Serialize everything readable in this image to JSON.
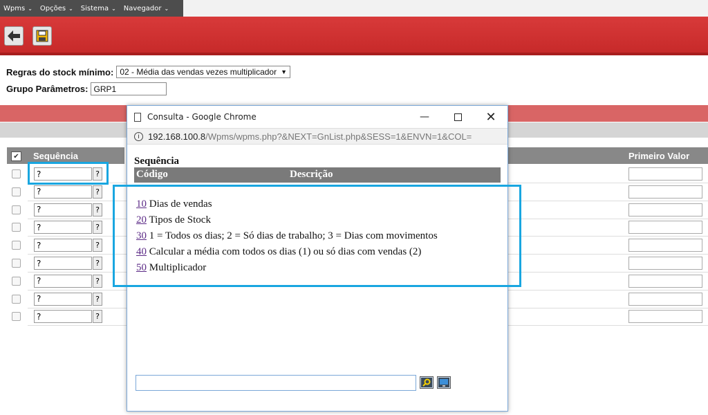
{
  "menubar": {
    "items": [
      {
        "label": "Wpms"
      },
      {
        "label": "Opções"
      },
      {
        "label": "Sistema"
      },
      {
        "label": "Navegador"
      }
    ]
  },
  "form": {
    "regras_label": "Regras do stock mínimo:",
    "regras_value": "02 - Média das vendas vezes multiplicador",
    "grupo_label": "Grupo Parâmetros:",
    "grupo_value": "GRP1"
  },
  "grid": {
    "col_sequencia": "Sequência",
    "col_primeiro_valor": "Primeiro Valor",
    "row_value": "?",
    "lookup_label": "?",
    "row_count": 9
  },
  "popup": {
    "title": "Consulta - Google Chrome",
    "url_host": "192.168.100.8",
    "url_path": "/Wpms/wpms.php?&NEXT=GnList.php&SESS=1&ENVN=1&COL=",
    "heading": "Sequência",
    "col_codigo": "Código",
    "col_descricao": "Descrição",
    "items": [
      {
        "code": "10",
        "desc": "Dias de vendas"
      },
      {
        "code": "20",
        "desc": "Tipos de Stock"
      },
      {
        "code": "30",
        "desc": "1 = Todos os dias; 2 = Só dias de trabalho; 3 = Dias com movimentos"
      },
      {
        "code": "40",
        "desc": "Calcular a média com todos os dias (1) ou só dias com vendas (2)"
      },
      {
        "code": "50",
        "desc": "Multiplicador"
      }
    ],
    "search_value": ""
  },
  "colors": {
    "toolbar_red": "#d83a3a",
    "highlight": "#19a6e0",
    "header_grey": "#888888"
  }
}
